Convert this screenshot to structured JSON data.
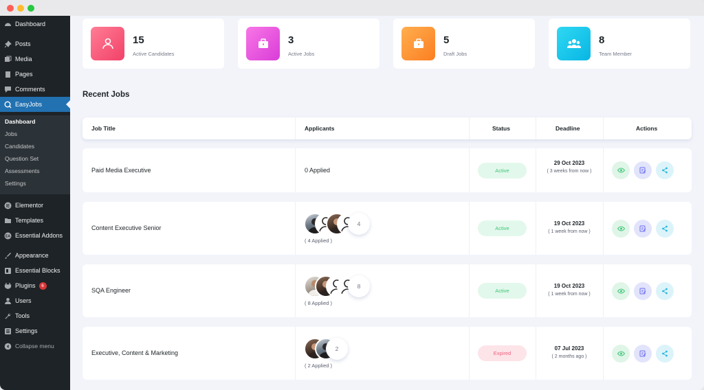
{
  "sidebar": {
    "items": [
      {
        "label": "Dashboard",
        "icon": "dashboard-icon"
      },
      {
        "label": "Posts",
        "icon": "pin-icon"
      },
      {
        "label": "Media",
        "icon": "media-icon"
      },
      {
        "label": "Pages",
        "icon": "pages-icon"
      },
      {
        "label": "Comments",
        "icon": "comment-icon"
      },
      {
        "label": "EasyJobs",
        "icon": "easyjobs-icon"
      },
      {
        "label": "Elementor",
        "icon": "elementor-icon"
      },
      {
        "label": "Templates",
        "icon": "folder-icon"
      },
      {
        "label": "Essential Addons",
        "icon": "ea-icon"
      },
      {
        "label": "Appearance",
        "icon": "brush-icon"
      },
      {
        "label": "Essential Blocks",
        "icon": "blocks-icon"
      },
      {
        "label": "Plugins",
        "icon": "plug-icon",
        "badge": "6"
      },
      {
        "label": "Users",
        "icon": "user-icon"
      },
      {
        "label": "Tools",
        "icon": "wrench-icon"
      },
      {
        "label": "Settings",
        "icon": "settings-icon"
      }
    ],
    "submenu": [
      "Dashboard",
      "Jobs",
      "Candidates",
      "Question Set",
      "Assessments",
      "Settings"
    ],
    "collapse_label": "Collapse menu"
  },
  "stats": [
    {
      "value": "15",
      "label": "Active Candidates",
      "icon": "candidates-icon",
      "color_from": "#ff7d95",
      "color_to": "#f24168"
    },
    {
      "value": "3",
      "label": "Active Jobs",
      "icon": "briefcase-icon",
      "color_from": "#f876e6",
      "color_to": "#d93dd8"
    },
    {
      "value": "5",
      "label": "Draft Jobs",
      "icon": "briefcase-icon",
      "color_from": "#ffae4f",
      "color_to": "#fb7f21"
    },
    {
      "value": "8",
      "label": "Team Member",
      "icon": "team-icon",
      "color_from": "#2fd8f2",
      "color_to": "#08b6e4"
    }
  ],
  "recent_jobs_title": "Recent Jobs",
  "table": {
    "headers": [
      "Job Title",
      "Applicants",
      "Status",
      "Deadline",
      "Actions"
    ],
    "rows": [
      {
        "title": "Paid Media Executive",
        "applied": "0 Applied",
        "avatars": [],
        "count": "",
        "status": "Active",
        "date": "29 Oct 2023",
        "relative": "( 3 weeks from now )"
      },
      {
        "title": "Content Executive Senior",
        "applied": "( 4 Applied )",
        "avatars": [
          "photo",
          "silhouette",
          "photo",
          "silhouette"
        ],
        "count": "4",
        "status": "Active",
        "date": "19 Oct 2023",
        "relative": "( 1 week from now )"
      },
      {
        "title": "SQA Engineer",
        "applied": "( 8 Applied )",
        "avatars": [
          "photo",
          "photo",
          "silhouette",
          "silhouette"
        ],
        "count": "8",
        "status": "Active",
        "date": "19 Oct 2023",
        "relative": "( 1 week from now )"
      },
      {
        "title": "Executive, Content & Marketing",
        "applied": "( 2 Applied )",
        "avatars": [
          "photo",
          "photo"
        ],
        "count": "2",
        "status": "Expired",
        "date": "07 Jul 2023",
        "relative": "( 2 months ago )"
      }
    ]
  },
  "colors": {
    "sidebar_bg": "#1d2327",
    "sidebar_active": "#2271b1",
    "active_status": "#3ec678",
    "expired_status": "#ef5f7d"
  }
}
